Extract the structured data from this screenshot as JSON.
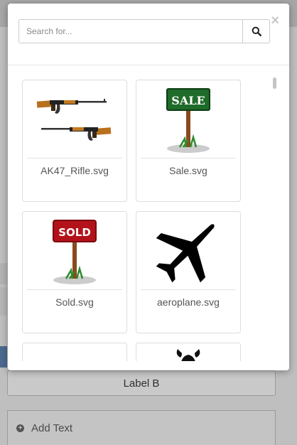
{
  "background": {
    "label_b": "Label B",
    "add_text": "Add Text"
  },
  "modal": {
    "close_glyph": "×",
    "search": {
      "placeholder": "Search for..."
    },
    "search_button_icon": "search-icon",
    "files": [
      {
        "name": "AK47_Rifle.svg",
        "icon": "rifle-image"
      },
      {
        "name": "Sale.svg",
        "icon": "sale-sign-image"
      },
      {
        "name": "Sold.svg",
        "icon": "sold-sign-image"
      },
      {
        "name": "aeroplane.svg",
        "icon": "airplane-image"
      },
      {
        "name": "",
        "icon": "empty-image"
      },
      {
        "name": "",
        "icon": "viking-helmet-image"
      }
    ],
    "sign_text": {
      "sale": "SALE",
      "sold": "SOLD"
    }
  },
  "colors": {
    "sale_green": "#1f6b2a",
    "sold_red": "#b3121b",
    "post_brown": "#8a4a1c"
  }
}
